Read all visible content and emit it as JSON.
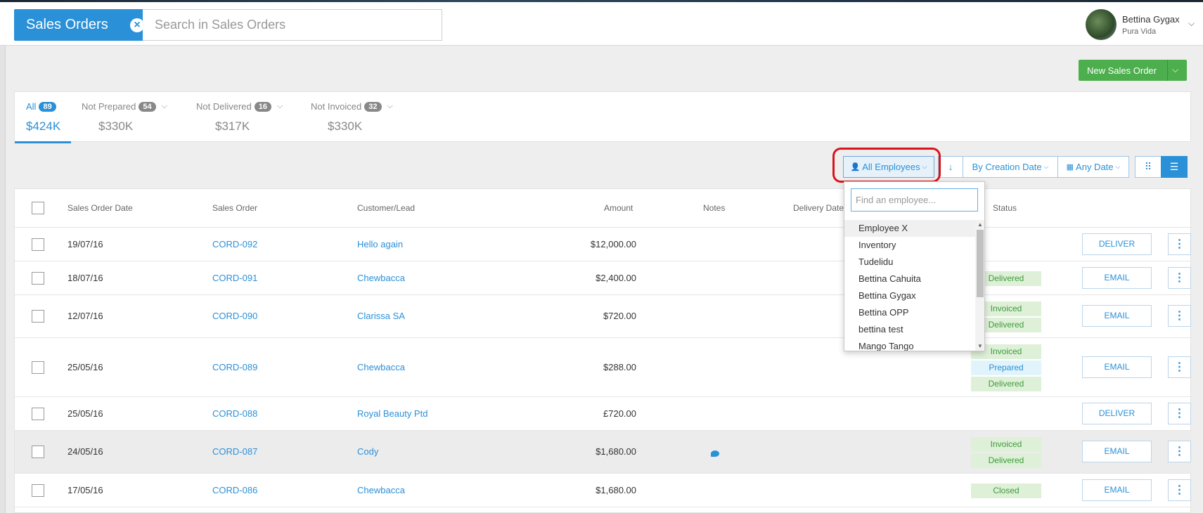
{
  "header": {
    "title": "Sales Orders",
    "close_icon": "×",
    "search_placeholder": "Search in Sales Orders",
    "user_name": "Bettina Gygax",
    "user_company": "Pura Vida"
  },
  "toolbar": {
    "new_order_label": "New Sales Order"
  },
  "tabs": [
    {
      "name": "All",
      "count": "89",
      "amount": "$424K",
      "active": true
    },
    {
      "name": "Not Prepared",
      "count": "54",
      "amount": "$330K"
    },
    {
      "name": "Not Delivered",
      "count": "16",
      "amount": "$317K"
    },
    {
      "name": "Not Invoiced",
      "count": "32",
      "amount": "$330K"
    }
  ],
  "filters": {
    "employees": "All Employees",
    "sort_dir_icon": "↓",
    "sort_by": "By Creation Date",
    "date_range": "Any Date"
  },
  "columns": {
    "date": "Sales Order Date",
    "order": "Sales Order",
    "customer": "Customer/Lead",
    "amount": "Amount",
    "notes": "Notes",
    "delivery": "Delivery Date",
    "status": "Status"
  },
  "rows": [
    {
      "date": "19/07/16",
      "order": "CORD-092",
      "customer": "Hello again",
      "amount": "$12,000.00",
      "action": "DELIVER"
    },
    {
      "date": "18/07/16",
      "order": "CORD-091",
      "customer": "Chewbacca",
      "amount": "$2,400.00",
      "status1": "Delivered",
      "action": "EMAIL"
    },
    {
      "date": "12/07/16",
      "order": "CORD-090",
      "customer": "Clarissa SA",
      "amount": "$720.00",
      "status1": "Invoiced",
      "status2": "Delivered",
      "action": "EMAIL"
    },
    {
      "date": "25/05/16",
      "order": "CORD-089",
      "customer": "Chewbacca",
      "amount": "$288.00",
      "status1": "Invoiced",
      "status2": "Prepared",
      "status3": "Delivered",
      "action": "EMAIL"
    },
    {
      "date": "25/05/16",
      "order": "CORD-088",
      "customer": "Royal Beauty Ptd",
      "amount": "£720.00",
      "action": "DELIVER"
    },
    {
      "date": "24/05/16",
      "order": "CORD-087",
      "customer": "Cody",
      "amount": "$1,680.00",
      "status1": "Invoiced",
      "status2": "Delivered",
      "action": "EMAIL"
    },
    {
      "date": "17/05/16",
      "order": "CORD-086",
      "customer": "Chewbacca",
      "amount": "$1,680.00",
      "status1": "Closed",
      "action": "EMAIL"
    }
  ],
  "employee_dropdown": {
    "placeholder": "Find an employee...",
    "items": [
      "Employee X",
      "Inventory",
      "Tudelidu",
      "Bettina Cahuita",
      "Bettina Gygax",
      "Bettina OPP",
      "bettina test",
      "Mango Tango"
    ]
  }
}
